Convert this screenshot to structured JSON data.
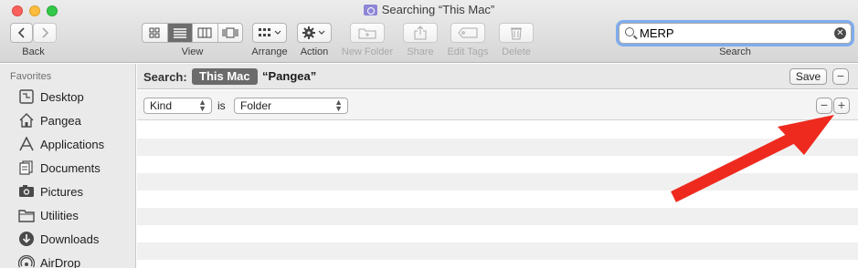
{
  "window": {
    "title": "Searching “This Mac”"
  },
  "toolbar": {
    "back_label": "Back",
    "view_label": "View",
    "arrange_label": "Arrange",
    "action_label": "Action",
    "new_folder_label": "New Folder",
    "share_label": "Share",
    "edit_tags_label": "Edit Tags",
    "delete_label": "Delete",
    "search_label": "Search",
    "search_value": "MERP",
    "view_modes": [
      "icon-view",
      "list-view",
      "column-view",
      "cover-flow-view"
    ],
    "active_view": "list-view"
  },
  "sidebar": {
    "heading": "Favorites",
    "items": [
      {
        "label": "Desktop",
        "icon": "desktop-icon"
      },
      {
        "label": "Pangea",
        "icon": "home-icon"
      },
      {
        "label": "Applications",
        "icon": "applications-icon"
      },
      {
        "label": "Documents",
        "icon": "documents-icon"
      },
      {
        "label": "Pictures",
        "icon": "pictures-icon"
      },
      {
        "label": "Utilities",
        "icon": "folder-icon"
      },
      {
        "label": "Downloads",
        "icon": "downloads-icon"
      },
      {
        "label": "AirDrop",
        "icon": "airdrop-icon"
      }
    ]
  },
  "scope": {
    "search_label": "Search:",
    "this_mac": "This Mac",
    "pangea": "“Pangea”",
    "save_label": "Save",
    "remove_symbol": "−"
  },
  "criteria": {
    "attribute": "Kind",
    "operator": "is",
    "value": "Folder",
    "remove_symbol": "−",
    "add_symbol": "+"
  },
  "annotation": {
    "arrow_color": "#ee2a1f"
  }
}
